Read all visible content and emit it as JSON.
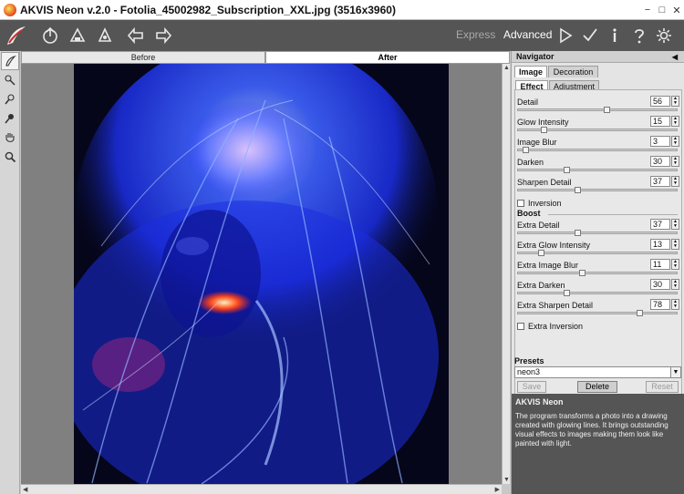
{
  "window": {
    "title": "AKVIS Neon v.2.0 - Fotolia_45002982_Subscription_XXL.jpg (3516x3960)",
    "controls": [
      "−",
      "□",
      "✕"
    ]
  },
  "toolbar": {
    "modes": {
      "express": "Express",
      "advanced": "Advanced"
    },
    "icons": [
      "open-image-icon",
      "save-image-icon",
      "print-icon",
      "undo-arrow-icon",
      "redo-arrow-icon",
      "run-icon",
      "apply-check-icon",
      "info-icon",
      "help-icon",
      "settings-gear-icon"
    ]
  },
  "canvas": {
    "tabs": {
      "before": "Before",
      "after": "After"
    }
  },
  "panel": {
    "title": "Navigator",
    "tabs": {
      "image": "Image",
      "decoration": "Decoration"
    },
    "subtabs": {
      "effect": "Effect",
      "adjustment": "Adjustment"
    },
    "params": [
      {
        "label": "Detail",
        "value": "56",
        "fill": 0.56
      },
      {
        "label": "Glow Intensity",
        "value": "15",
        "fill": 0.15
      },
      {
        "label": "Image Blur",
        "value": "3",
        "fill": 0.03
      },
      {
        "label": "Darken",
        "value": "30",
        "fill": 0.3
      },
      {
        "label": "Sharpen Detail",
        "value": "37",
        "fill": 0.37
      }
    ],
    "inversion_label": "Inversion",
    "boost_label": "Boost",
    "boost_params": [
      {
        "label": "Extra Detail",
        "value": "37",
        "fill": 0.37
      },
      {
        "label": "Extra Glow Intensity",
        "value": "13",
        "fill": 0.13
      },
      {
        "label": "Extra Image Blur",
        "value": "11",
        "fill": 0.4
      },
      {
        "label": "Extra Darken",
        "value": "30",
        "fill": 0.3
      },
      {
        "label": "Extra Sharpen Detail",
        "value": "78",
        "fill": 0.78
      }
    ],
    "extra_inversion_label": "Extra Inversion",
    "presets": {
      "heading": "Presets",
      "selected": "neon3",
      "save": "Save",
      "delete": "Delete",
      "reset": "Reset"
    },
    "help": {
      "title": "AKVIS Neon",
      "text": "The program transforms a photo into a drawing created with glowing lines. It brings outstanding visual effects to images making them look like painted with light."
    }
  }
}
